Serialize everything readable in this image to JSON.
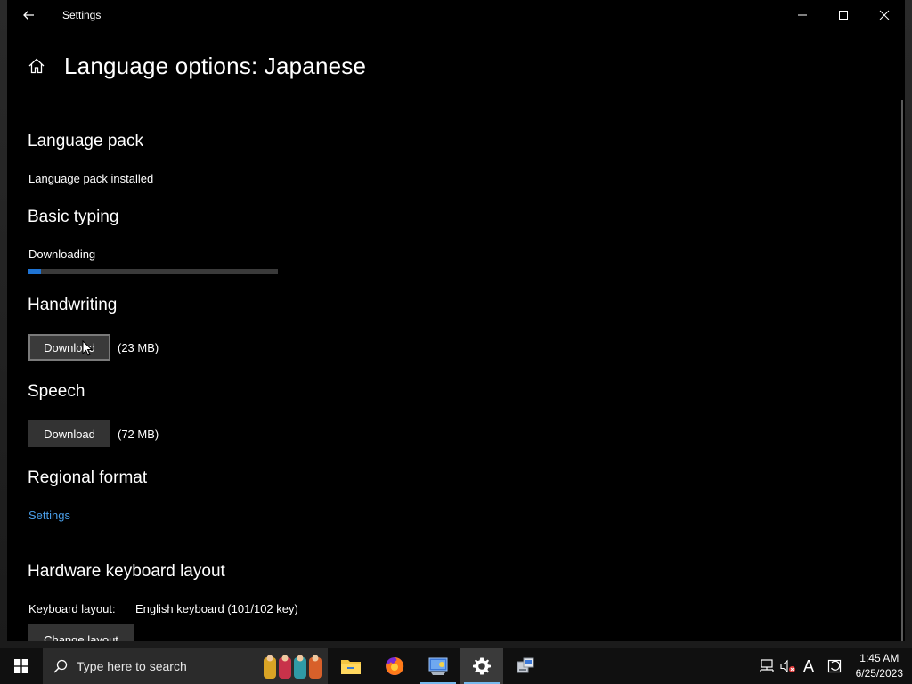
{
  "window": {
    "title": "Settings",
    "back_icon": "arrow-left-icon",
    "controls": [
      "minimize-icon",
      "maximize-icon",
      "close-icon"
    ]
  },
  "page": {
    "home_icon": "home-icon",
    "title": "Language options: Japanese"
  },
  "sections": {
    "language_pack": {
      "title": "Language pack",
      "status": "Language pack installed"
    },
    "basic_typing": {
      "title": "Basic typing",
      "status": "Downloading",
      "progress": 0.05
    },
    "handwriting": {
      "title": "Handwriting",
      "button_label": "Download",
      "size": "(23 MB)"
    },
    "speech": {
      "title": "Speech",
      "button_label": "Download",
      "size": "(72 MB)"
    },
    "regional_format": {
      "title": "Regional format",
      "link_label": "Settings"
    },
    "hardware_keyboard": {
      "title": "Hardware keyboard layout",
      "layout_label": "Keyboard layout:",
      "layout_value": "English keyboard (101/102 key)",
      "change_button_label": "Change layout"
    }
  },
  "taskbar": {
    "search_placeholder": "Type here to search",
    "apps": [
      "file-explorer-icon",
      "firefox-icon",
      "control-panel-icon",
      "settings-gear-icon",
      "network-app-icon"
    ],
    "active_app": "settings-gear-icon",
    "tray": [
      "network-icon",
      "volume-muted-icon",
      "ime-mode-icon",
      "action-center-icon"
    ],
    "ime_glyph": "A",
    "time": "1:45 AM",
    "date": "6/25/2023"
  },
  "colors": {
    "background": "#000000",
    "accent": "#1f74d4",
    "link": "#4a9ee8",
    "button": "#333333"
  }
}
